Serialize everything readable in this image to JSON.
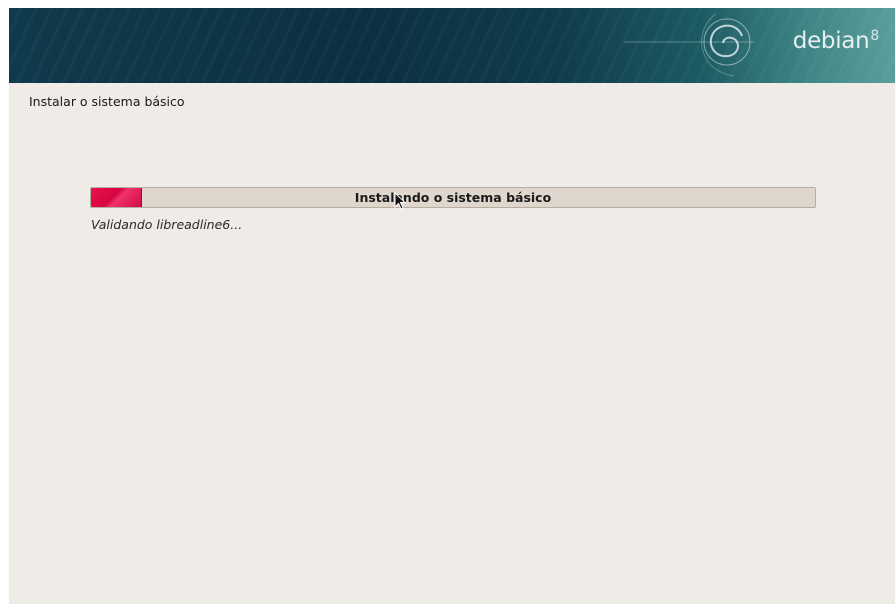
{
  "banner": {
    "brand_name": "debian",
    "brand_version": "8",
    "logo_icon": "debian-swirl-icon"
  },
  "step": {
    "title": "Instalar o sistema básico"
  },
  "progress": {
    "label": "Instalando o sistema básico",
    "fraction": 0.07,
    "fill_color": "#e0104c"
  },
  "status": {
    "text": "Validando libreadline6..."
  }
}
